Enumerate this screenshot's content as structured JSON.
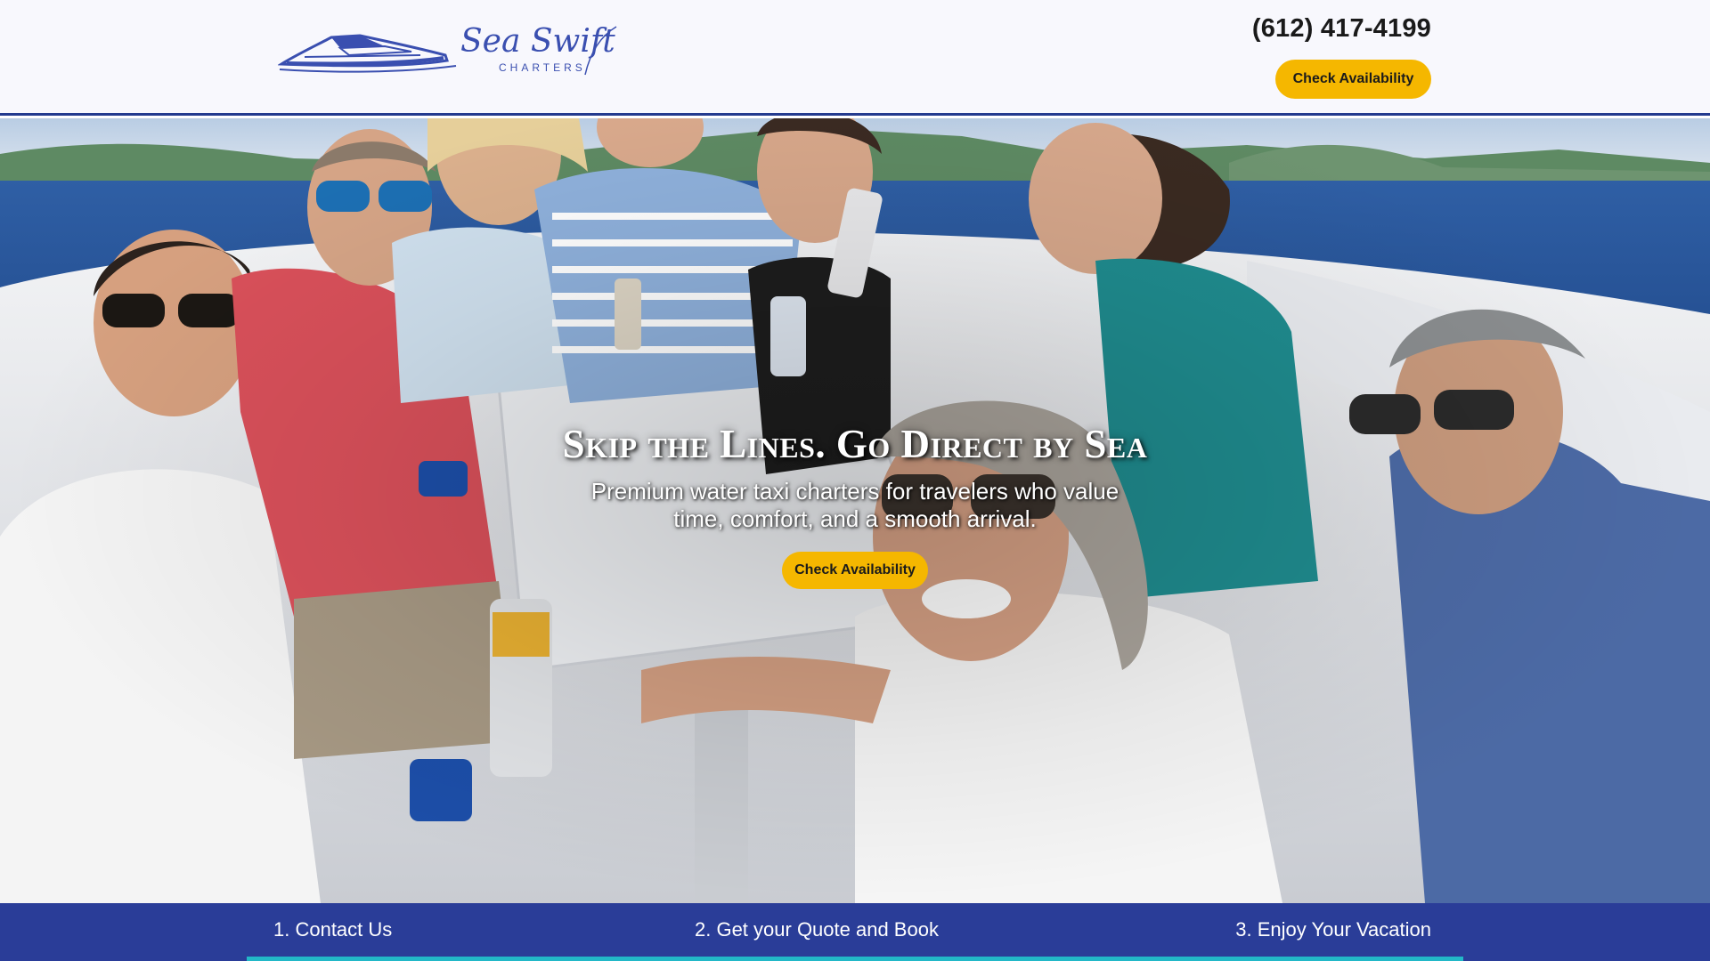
{
  "header": {
    "logo": {
      "brand": "Sea Swift",
      "sub": "CHARTERS"
    },
    "phone": "(612) 417-4199",
    "cta_label": "Check Availability"
  },
  "hero": {
    "title": "Skip the Lines. Go Direct by Sea",
    "subtitle": "Premium water taxi charters for travelers who value time, comfort, and a smooth arrival.",
    "cta_label": "Check Availability"
  },
  "steps": [
    {
      "label": "1. Contact Us"
    },
    {
      "label": "2. Get your Quote and Book"
    },
    {
      "label": "3. Enjoy Your Vacation"
    }
  ],
  "colors": {
    "brand_blue": "#2a3d98",
    "accent_yellow": "#f5b700",
    "accent_teal": "#22b8c7",
    "logo_blue": "#3a4fb0"
  },
  "icons": {
    "logo_mark": "speedboat-icon"
  }
}
